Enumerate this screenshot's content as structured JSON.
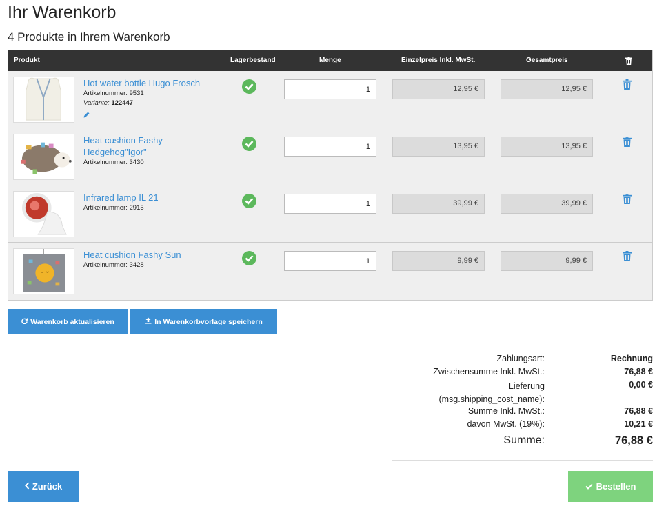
{
  "page": {
    "title": "Ihr Warenkorb",
    "subtitle": "4 Produkte in Ihrem Warenkorb"
  },
  "table": {
    "headers": {
      "product": "Produkt",
      "stock": "Lagerbestand",
      "qty": "Menge",
      "unit_price": "Einzelpreis Inkl. MwSt.",
      "total_price": "Gesamtpreis"
    },
    "rows": [
      {
        "name": "Hot water bottle Hugo Frosch",
        "article": "Artikelnummer: 9531",
        "variant_label": "Variante",
        "variant_value": "122447",
        "qty": "1",
        "unit_price": "12,95 €",
        "total_price": "12,95 €"
      },
      {
        "name": "Heat cushion Fashy Hedgehog\"Igor\"",
        "article": "Artikelnummer: 3430",
        "qty": "1",
        "unit_price": "13,95 €",
        "total_price": "13,95 €"
      },
      {
        "name": "Infrared lamp IL 21",
        "article": "Artikelnummer: 2915",
        "qty": "1",
        "unit_price": "39,99 €",
        "total_price": "39,99 €"
      },
      {
        "name": "Heat cushion Fashy Sun",
        "article": "Artikelnummer: 3428",
        "qty": "1",
        "unit_price": "9,99 €",
        "total_price": "9,99 €"
      }
    ]
  },
  "actions": {
    "update": "Warenkorb aktualisieren",
    "save_template": "In Warenkorbvorlage speichern",
    "back": "Zurück",
    "order": "Bestellen"
  },
  "summary": {
    "payment_label": "Zahlungsart:",
    "payment_value": "Rechnung",
    "subtotal_label": "Zwischensumme Inkl. MwSt.:",
    "subtotal_value": "76,88 €",
    "delivery_label_1": "Lieferung",
    "delivery_label_2": "(msg.shipping_cost_name):",
    "delivery_value": "0,00 €",
    "sum_incl_label": "Summe Inkl. MwSt.:",
    "sum_incl_value": "76,88 €",
    "vat_label": "davon MwSt. (19%):",
    "vat_value": "10,21 €",
    "total_label": "Summe:",
    "total_value": "76,88 €"
  },
  "colors": {
    "accent": "#3b8fd4",
    "success": "#5cb85c",
    "order_button": "#7ed37e",
    "header_bg": "#333333"
  }
}
